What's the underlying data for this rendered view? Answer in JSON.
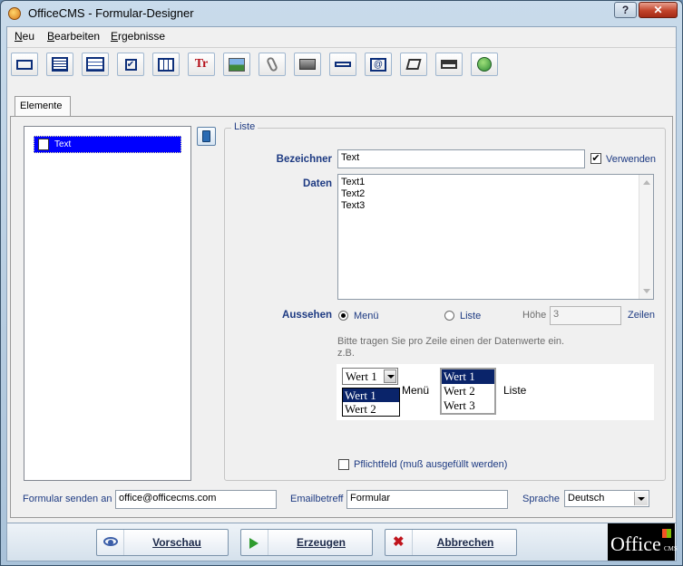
{
  "window": {
    "title": "OfficeCMS - Formular-Designer",
    "help_label": "?",
    "close_label": "✕"
  },
  "menu": [
    {
      "hot": "N",
      "rest": "eu"
    },
    {
      "hot": "B",
      "rest": "earbeiten"
    },
    {
      "hot": "E",
      "rest": "rgebnisse"
    }
  ],
  "toolbar_icons": [
    "textfield-icon",
    "textarea-icon",
    "list-icon",
    "checkbox-icon",
    "table-icon",
    "text-format-icon",
    "image-icon",
    "attachment-icon",
    "frame-icon",
    "separator-icon",
    "email-icon",
    "note-icon",
    "group-icon",
    "globe-icon"
  ],
  "tab": {
    "label": "Elemente"
  },
  "element_list": {
    "items": [
      {
        "label": "Text"
      }
    ]
  },
  "group": {
    "legend": "Liste"
  },
  "form": {
    "bezeichner_label": "Bezeichner",
    "bezeichner_value": "Text",
    "verwenden_label": "Verwenden",
    "verwenden_checked": "✔",
    "daten_label": "Daten",
    "daten_lines": [
      "Text1",
      "Text2",
      "Text3"
    ],
    "aussehen_label": "Aussehen",
    "option_menu": "Menü",
    "option_liste": "Liste",
    "hoehe_label": "Höhe",
    "hoehe_value": "3",
    "zeilen_label": "Zeilen",
    "hint_line1": "Bitte tragen Sie pro Zeile einen der Datenwerte ein.",
    "hint_line2": "z.B.",
    "example": {
      "combo_value": "Wert 1",
      "dropdown": [
        "Wert 1",
        "Wert 2"
      ],
      "menu_caption": "Menü",
      "listbox": [
        "Wert 1",
        "Wert 2",
        "Wert 3"
      ],
      "list_caption": "Liste"
    },
    "pflichtfeld_label": "Pflichtfeld (muß ausgefüllt werden)"
  },
  "bottom": {
    "send_label": "Formular senden an",
    "send_value": "office@officecms.com",
    "subject_label": "Emailbetreff",
    "subject_value": "Formular",
    "language_label": "Sprache",
    "language_value": "Deutsch"
  },
  "buttons": {
    "preview": "Vorschau",
    "generate": "Erzeugen",
    "cancel": "Abbrechen"
  },
  "logo": {
    "main": "Office",
    "sub": "CMS"
  }
}
